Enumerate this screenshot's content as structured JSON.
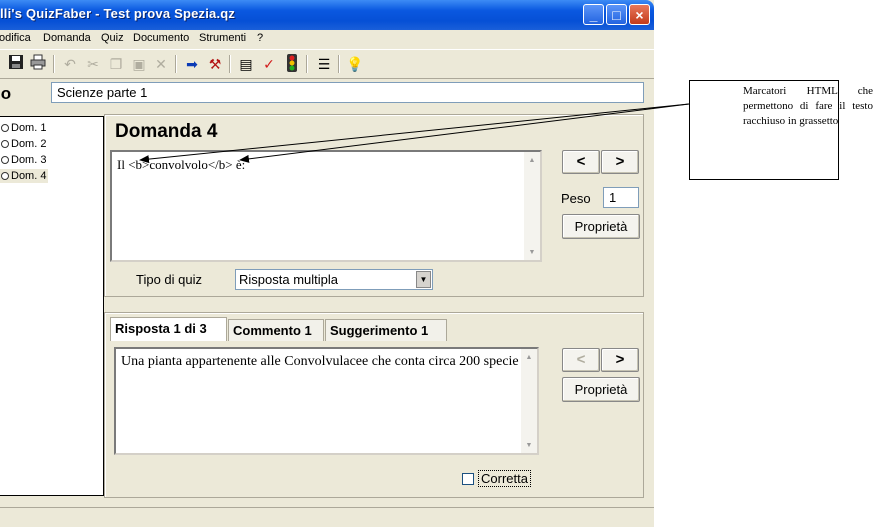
{
  "window": {
    "title": "lli's QuizFaber - Test prova Spezia.qz",
    "controls": {
      "minimize": "_",
      "maximize": "□",
      "close": "×"
    }
  },
  "menu": [
    "odifica",
    "Domanda",
    "Quiz",
    "Documento",
    "Strumenti",
    "?"
  ],
  "toolbar": {
    "icons": [
      "save-icon",
      "print-icon",
      "undo-icon",
      "cut-icon",
      "copy-icon",
      "paste-icon",
      "delete-icon",
      "arrow-icon",
      "hammer-icon",
      "properties-icon",
      "check-icon",
      "traffic-light-icon",
      "document-icon",
      "help-icon"
    ]
  },
  "titolo": {
    "label": "lo",
    "value": "Scienze parte 1"
  },
  "questions": [
    "Dom. 1",
    "Dom. 2",
    "Dom. 3",
    "Dom. 4"
  ],
  "domanda": {
    "title": "Domanda 4",
    "text": "Il <b>convolvolo</b> è:",
    "prev": "<",
    "next": ">",
    "peso_label": "Peso",
    "peso_value": "1",
    "proprieta": "Proprietà",
    "tipo_label": "Tipo di quiz",
    "tipo_value": "Risposta multipla"
  },
  "tabs": [
    "Risposta 1 di 3",
    "Commento 1",
    "Suggerimento 1"
  ],
  "risposta": {
    "text": "Una pianta appartenente alle Convolvulacee che conta circa 200 specie",
    "prev": "<",
    "next": ">",
    "proprieta": "Proprietà",
    "corretta": "Corretta"
  },
  "callout": {
    "text": "Marcatori HTML che permettono di fare il testo racchiuso in grassetto"
  },
  "colors": {
    "title_bar": "#0650d6",
    "window_bg": "#ece9d8",
    "close": "#c33b1b"
  }
}
